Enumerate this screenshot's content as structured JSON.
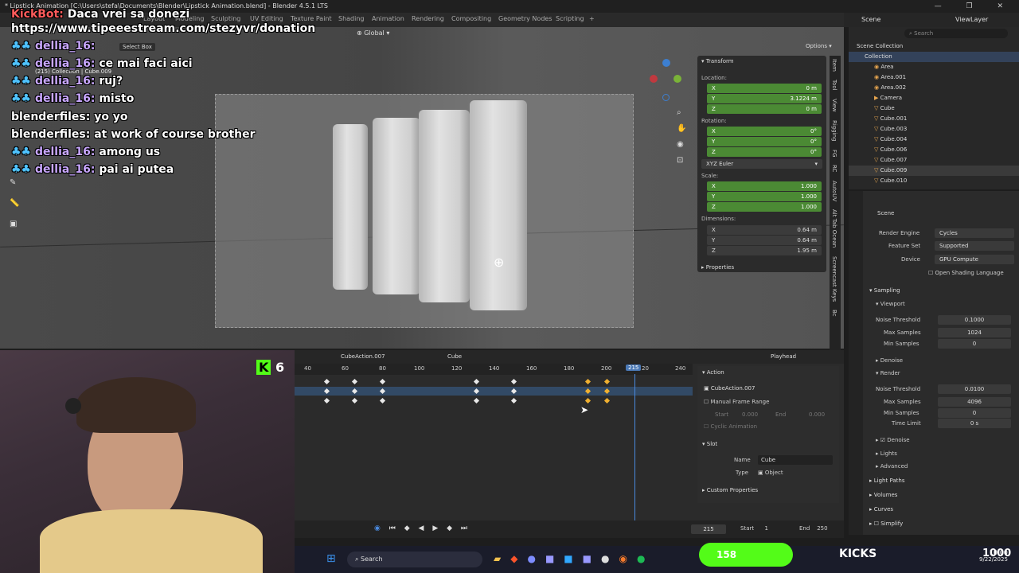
{
  "title_bar": {
    "text": "* Lipstick Animation [C:\\Users\\stefa\\Documents\\Blender\\Lipstick Animation.blend] - Blender 4.5.1 LTS",
    "controls": [
      "—",
      "❐",
      "✕"
    ]
  },
  "menubar": {
    "workspaces": [
      "Layout",
      "Modeling",
      "Sculpting",
      "UV Editing",
      "Texture Paint",
      "Shading",
      "Animation",
      "Rendering",
      "Compositing",
      "Geometry Nodes",
      "Scripting",
      "+"
    ]
  },
  "viewport": {
    "orientation": "Global",
    "select_label": "Select Box",
    "options_label": "Options",
    "info_line": "(215) Collection | Cube.009"
  },
  "transform_panel": {
    "header": "Transform",
    "location_label": "Location:",
    "location": [
      {
        "axis": "X",
        "value": "0 m"
      },
      {
        "axis": "Y",
        "value": "3.1224 m"
      },
      {
        "axis": "Z",
        "value": "0 m"
      }
    ],
    "rotation_label": "Rotation:",
    "rotation": [
      {
        "axis": "X",
        "value": "0°"
      },
      {
        "axis": "Y",
        "value": "0°"
      },
      {
        "axis": "Z",
        "value": "0°"
      }
    ],
    "euler": "XYZ Euler",
    "scale_label": "Scale:",
    "scale": [
      {
        "axis": "X",
        "value": "1.000"
      },
      {
        "axis": "Y",
        "value": "1.000"
      },
      {
        "axis": "Z",
        "value": "1.000"
      }
    ],
    "dimensions_label": "Dimensions:",
    "dimensions": [
      {
        "axis": "X",
        "value": "0.64 m"
      },
      {
        "axis": "Y",
        "value": "0.64 m"
      },
      {
        "axis": "Z",
        "value": "1.95 m"
      }
    ],
    "properties_label": "Properties"
  },
  "side_tabs": [
    "Item",
    "Tool",
    "View",
    "Rigging",
    "FG",
    "RC",
    "AutoUV",
    "Alt Tab Ocean",
    "Screencast Keys",
    "Bc"
  ],
  "outliner": {
    "scene": "Scene",
    "view_layer": "ViewLayer",
    "search_placeholder": "Search",
    "scene_collection": "Scene Collection",
    "collection": "Collection",
    "items": [
      "Area",
      "Area.001",
      "Area.002",
      "Camera",
      "Cube",
      "Cube.001",
      "Cube.003",
      "Cube.004",
      "Cube.006",
      "Cube.007",
      "Cube.009",
      "Cube.010"
    ]
  },
  "properties": {
    "scene_label": "Scene",
    "render_engine_label": "Render Engine",
    "render_engine": "Cycles",
    "feature_set_label": "Feature Set",
    "feature_set": "Supported",
    "device_label": "Device",
    "device": "GPU Compute",
    "osl": "Open Shading Language",
    "sampling": "Sampling",
    "viewport": "Viewport",
    "noise_threshold_label": "Noise Threshold",
    "vp_noise": "0.1000",
    "max_samples_label": "Max Samples",
    "vp_max": "1024",
    "min_samples_label": "Min Samples",
    "vp_min": "0",
    "denoise": "Denoise",
    "render": "Render",
    "r_noise": "0.0100",
    "r_max": "4096",
    "r_min": "0",
    "time_limit_label": "Time Limit",
    "time_limit": "0 s",
    "lights": "Lights",
    "advanced": "Advanced",
    "light_paths": "Light Paths",
    "volumes": "Volumes",
    "curves": "Curves",
    "simplify": "Simplify"
  },
  "dopesheet": {
    "action": "CubeAction.007",
    "object": "Cube",
    "playhead_label": "Playhead",
    "ruler_ticks": [
      "40",
      "60",
      "80",
      "100",
      "120",
      "140",
      "160",
      "180",
      "200",
      "20",
      "240"
    ],
    "current_frame": "215",
    "action_panel": {
      "header": "Action",
      "action_name": "CubeAction.007",
      "manual_range": "Manual Frame Range",
      "start_label": "Start",
      "start_value": "0.000",
      "end_label": "End",
      "end_value": "0.000",
      "cyclic": "Cyclic Animation",
      "slot_header": "Slot",
      "name_label": "Name",
      "name_value": "Cube",
      "type_label": "Type",
      "type_value": "Object",
      "custom_props": "Custom Properties"
    }
  },
  "timeline": {
    "frame": "215",
    "start_label": "Start",
    "start": "1",
    "end_label": "End",
    "end": "250"
  },
  "taskbar": {
    "search": "Search",
    "time": "10:00",
    "date": "9/22/2025"
  },
  "overlay": {
    "chat": [
      {
        "user": "KickBot:",
        "msg": "Daca vrei sa donezi",
        "kind": "bot"
      },
      {
        "user": "",
        "msg": "https://www.tipeeestream.com/stezyvr/donation",
        "kind": "link"
      },
      {
        "user": "dellia_16:",
        "msg": "",
        "kind": "user"
      },
      {
        "user": "dellia_16:",
        "msg": "ce mai faci aici",
        "kind": "user"
      },
      {
        "user": "dellia_16:",
        "msg": "ruj?",
        "kind": "user"
      },
      {
        "user": "dellia_16:",
        "msg": "misto",
        "kind": "user"
      },
      {
        "user": "blenderfiles:",
        "msg": "yo yo",
        "kind": "plain"
      },
      {
        "user": "blenderfiles:",
        "msg": "at work of course brother",
        "kind": "plain"
      },
      {
        "user": "dellia_16:",
        "msg": "among us",
        "kind": "user"
      },
      {
        "user": "dellia_16:",
        "msg": "pai ai putea",
        "kind": "user"
      }
    ],
    "viewer_count": "6",
    "kick_badge": "158",
    "kicks_label": "KICKS",
    "kicks_value": "1000"
  }
}
